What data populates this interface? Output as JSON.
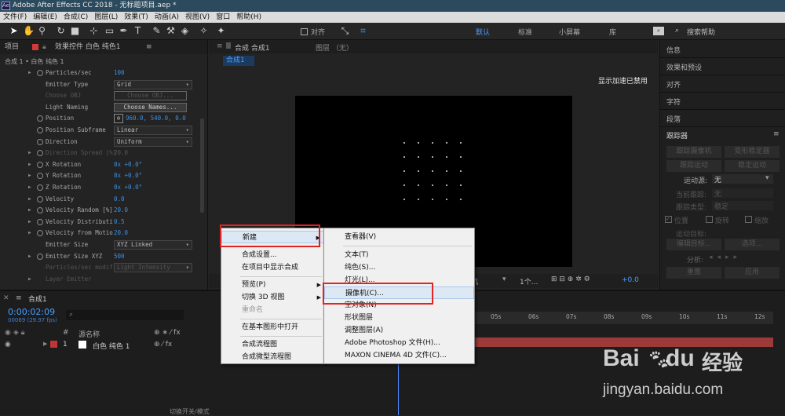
{
  "window": {
    "title": "Adobe After Effects CC 2018 - 无标题项目.aep *",
    "logo": "Ae"
  },
  "menubar": [
    "文件(F)",
    "编辑(E)",
    "合成(C)",
    "图层(L)",
    "效果(T)",
    "动画(A)",
    "视图(V)",
    "窗口",
    "帮助(H)"
  ],
  "toolbar": {
    "align_label": "对齐",
    "workspaces": [
      "默认",
      "标准",
      "小屏幕",
      "库"
    ],
    "search_placeholder": "搜索帮助"
  },
  "left_panel": {
    "tabs": [
      "项目",
      "效果控件 白色 纯色1"
    ],
    "breadcrumb": "合成 1 • 白色 纯色 1",
    "rows": [
      {
        "label": "Particles/sec",
        "value": "100",
        "type": "value",
        "stopwatch": true,
        "expand": true
      },
      {
        "label": "Emitter Type",
        "value": "Grid",
        "type": "dropdown"
      },
      {
        "label": "Choose OBJ",
        "value": "Choose OBJ...",
        "type": "button",
        "disabled": true
      },
      {
        "label": "Light Naming",
        "value": "Choose Names...",
        "type": "button"
      },
      {
        "label": "Position",
        "value": "960.0, 540.0, 0.0",
        "type": "value",
        "stopwatch": true,
        "target": true
      },
      {
        "label": "Position Subframe",
        "value": "Linear",
        "type": "dropdown",
        "stopwatch": true
      },
      {
        "label": "Direction",
        "value": "Uniform",
        "type": "dropdown",
        "stopwatch": true
      },
      {
        "label": "Direction Spread [%]",
        "value": "20.0",
        "type": "value",
        "stopwatch": true,
        "expand": true,
        "disabled": true
      },
      {
        "label": "X Rotation",
        "value": "0x +0.0°",
        "type": "value",
        "stopwatch": true,
        "expand": true
      },
      {
        "label": "Y Rotation",
        "value": "0x +0.0°",
        "type": "value",
        "stopwatch": true,
        "expand": true
      },
      {
        "label": "Z Rotation",
        "value": "0x +0.0°",
        "type": "value",
        "stopwatch": true,
        "expand": true
      },
      {
        "label": "Velocity",
        "value": "0.0",
        "type": "value",
        "stopwatch": true,
        "expand": true
      },
      {
        "label": "Velocity Random [%]",
        "value": "20.0",
        "type": "value",
        "stopwatch": true,
        "expand": true
      },
      {
        "label": "Velocity Distributi",
        "value": "0.5",
        "type": "value",
        "stopwatch": true,
        "expand": true
      },
      {
        "label": "Velocity from Motio",
        "value": "20.0",
        "type": "value",
        "stopwatch": true,
        "expand": true
      },
      {
        "label": "Emitter Size",
        "value": "XYZ Linked",
        "type": "dropdown"
      },
      {
        "label": "Emitter Size XYZ",
        "value": "500",
        "type": "value",
        "stopwatch": true,
        "expand": true
      },
      {
        "label": "Particles/sec modifier",
        "value": "Light Intensity",
        "type": "dropdown",
        "disabled": true
      },
      {
        "label": "Layer Emitter",
        "value": "",
        "type": "value",
        "expand": true,
        "disabled": true
      }
    ]
  },
  "center": {
    "tabs": [
      "合成 合成1",
      "图层 （无）"
    ],
    "comp_tab": "合成1",
    "accel_text": "显示加速已禁用",
    "bottom_controls": {
      "camera": "摄像机",
      "views": "1个...",
      "offset": "+0.0"
    }
  },
  "right_panel": {
    "items": [
      "信息",
      "效果和预设",
      "对齐",
      "字符",
      "段落",
      "跟踪器"
    ],
    "tracker": {
      "track_camera": "跟踪摄像机",
      "warp": "变形稳定器",
      "track_motion": "跟踪运动",
      "stabilize": "稳定运动",
      "motion_source_label": "运动源:",
      "motion_source": "无",
      "current_track_label": "当前跟踪:",
      "current_track": "无",
      "track_type_label": "跟踪类型:",
      "track_type": "稳定",
      "position": "位置",
      "rotation": "旋转",
      "scale": "缩放",
      "motion_target": "运动目标:",
      "edit_target": "编辑目标...",
      "options": "选项...",
      "analyze": "分析:",
      "reset": "重置",
      "apply": "应用"
    }
  },
  "timeline": {
    "comp_tab": "合成1",
    "timecode": "0:00:02:09",
    "frames": "00069 (29.97 fps)",
    "header_cols": [
      "#",
      "源名称"
    ],
    "layer": {
      "index": "1",
      "name": "白色 纯色 1"
    },
    "ticks": [
      "05s",
      "06s",
      "07s",
      "08s",
      "09s",
      "10s",
      "11s",
      "12s"
    ],
    "footer": "切换开关/模式"
  },
  "context_menu": {
    "items": [
      {
        "label": "新建",
        "submenu": true
      },
      {
        "label": "合成设置..."
      },
      {
        "label": "在项目中显示合成"
      },
      {
        "label": "预览(P)",
        "submenu": true
      },
      {
        "label": "切换 3D 视图",
        "submenu": true
      },
      {
        "label": "重命名",
        "disabled": true
      },
      {
        "label": "在基本图形中打开"
      },
      {
        "label": "合成流程图"
      },
      {
        "label": "合成微型流程图"
      }
    ]
  },
  "submenu": {
    "items": [
      "查看器(V)",
      "文本(T)",
      "纯色(S)...",
      "灯光(L)...",
      "摄像机(C)...",
      "空对象(N)",
      "形状图层",
      "调整图层(A)",
      "Adobe Photoshop 文件(H)...",
      "MAXON CINEMA 4D 文件(C)..."
    ]
  },
  "watermark": {
    "brand": "Bai",
    "brand2": "du",
    "product": "经验",
    "url": "jingyan.baidu.com"
  },
  "colors": {
    "accent": "#3d8fe0",
    "highlight": "#e32222",
    "layer_bar": "#9c3a3a",
    "menu_bg": "#f0f0f0"
  }
}
